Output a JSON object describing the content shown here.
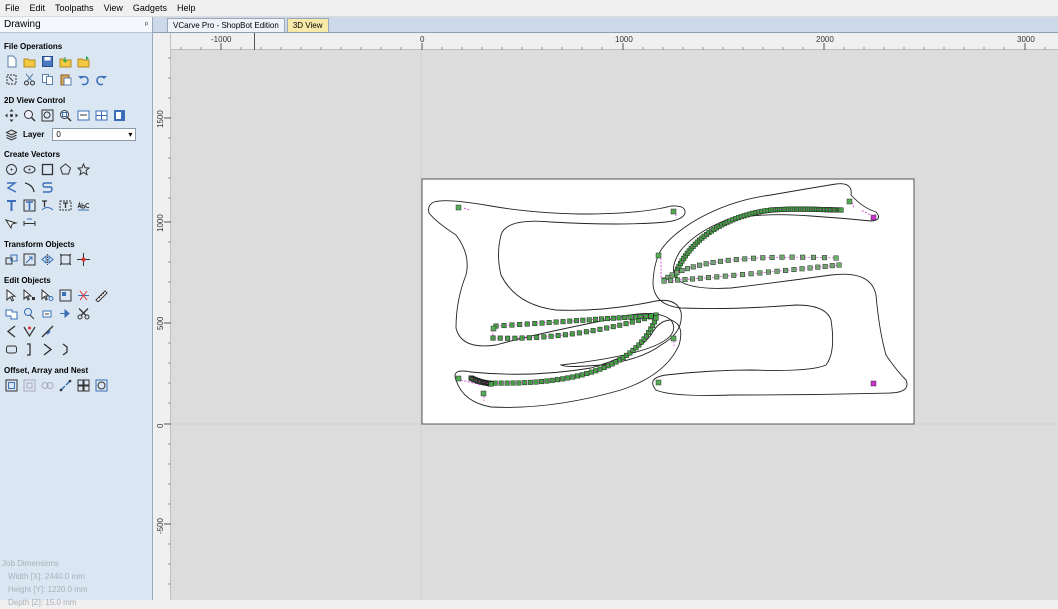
{
  "menu": [
    "File",
    "Edit",
    "Toolpaths",
    "View",
    "Gadgets",
    "Help"
  ],
  "panel": {
    "title": "Drawing",
    "pin_glyph": "ᵖ",
    "sections": {
      "file_operations": "File Operations",
      "view_control": "2D View Control",
      "create_vectors": "Create Vectors",
      "transform_objects": "Transform Objects",
      "edit_objects": "Edit Objects",
      "offset_array_nest": "Offset, Array and Nest"
    },
    "layer": {
      "label": "Layer",
      "value": "0"
    },
    "job_dimensions": {
      "title": "Job Dimensions",
      "width": "Width  [X]: 2440.0 mm",
      "height": "Height [Y]: 1220.0 mm",
      "depth": "Depth  [Z]: 15.0 mm"
    }
  },
  "tabs": {
    "active": "VCarve Pro - ShopBot Edition",
    "inactive": "3D View"
  },
  "rulers": {
    "top_labels": [
      "-1000",
      "0",
      "1000",
      "2000",
      "3000"
    ],
    "left_labels": [
      "1500",
      "1000",
      "500",
      "0",
      "-500"
    ]
  },
  "colors": {
    "panel_bg": "#dbe6f3",
    "canvas_bg": "#dcdcdc",
    "toolpath_green": "#3aa83a",
    "toolpath_magenta": "#cc33cc"
  }
}
